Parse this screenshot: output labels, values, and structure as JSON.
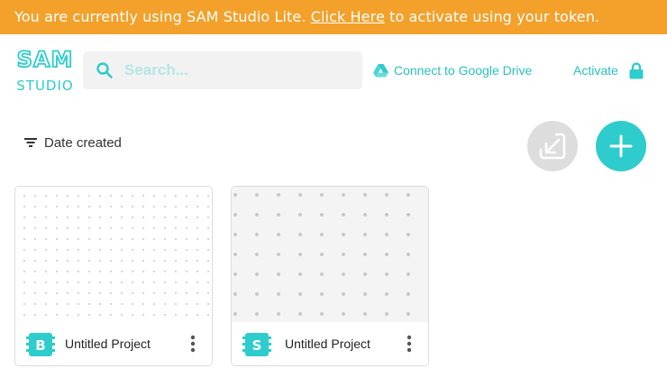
{
  "banner": {
    "text_before": "You are currently using SAM Studio Lite. ",
    "link_label": "Click Here",
    "text_after": " to activate using your token.",
    "color": "#f3a12b"
  },
  "logo": {
    "line1": "SAM",
    "line2": "STUDIO"
  },
  "search": {
    "placeholder": "Search...",
    "value": ""
  },
  "header": {
    "gdrive_label": "Connect to Google Drive",
    "activate_label": "Activate"
  },
  "toolbar": {
    "sort_label": "Date created"
  },
  "accent_color": "#2ecccc",
  "projects": [
    {
      "name": "Untitled Project",
      "badge": "B",
      "badge_icon": "block-code-icon"
    },
    {
      "name": "Untitled Project",
      "badge": "S",
      "badge_icon": "script-code-icon"
    }
  ]
}
